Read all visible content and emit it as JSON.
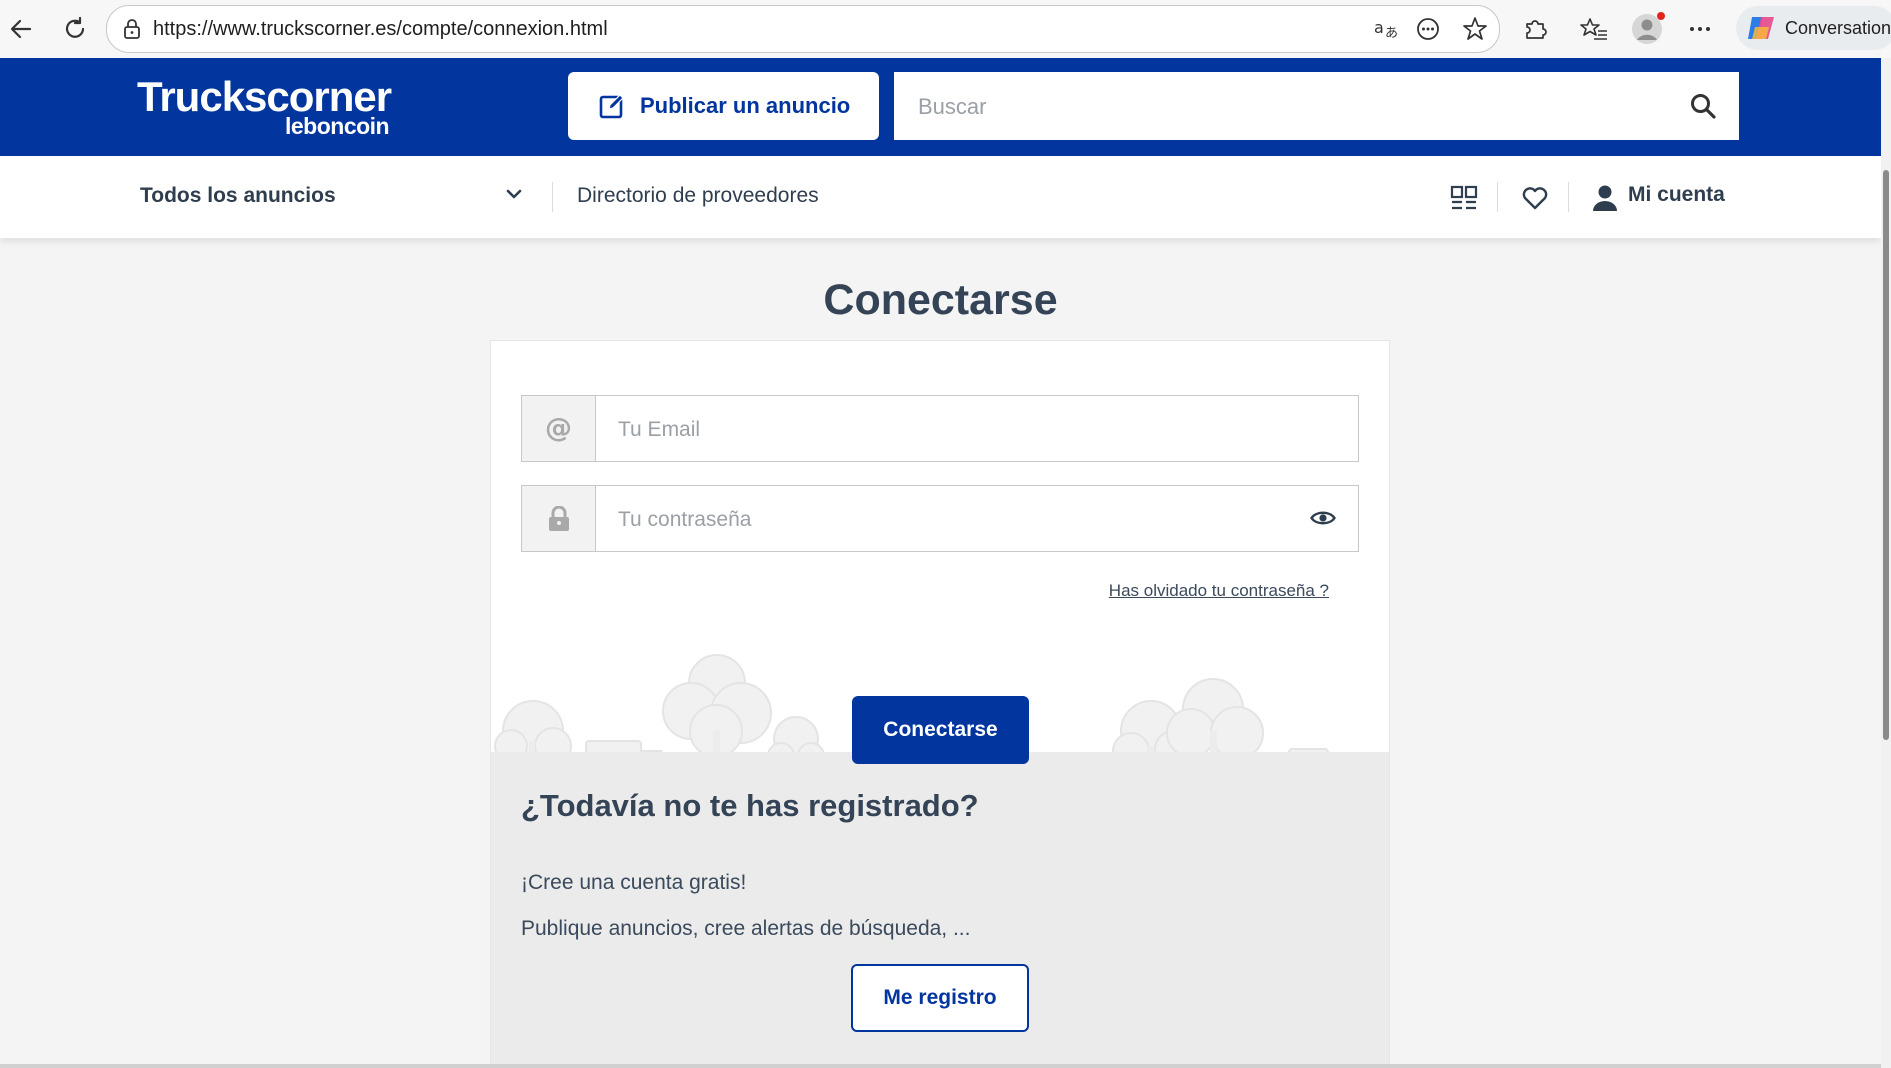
{
  "browser": {
    "url": "https://www.truckscorner.es/compte/connexion.html",
    "copilot_label": "Conversation"
  },
  "header": {
    "logo_main": "Truckscorner",
    "logo_sub": "leboncoin",
    "publish_label": "Publicar un anuncio",
    "search_placeholder": "Buscar"
  },
  "nav": {
    "all_ads": "Todos los anuncios",
    "directory": "Directorio de proveedores",
    "account": "Mi cuenta"
  },
  "login": {
    "title": "Conectarse",
    "email_placeholder": "Tu Email",
    "password_placeholder": "Tu contraseña",
    "forgot": "Has olvidado tu contraseña ?",
    "submit": "Conectarse"
  },
  "register": {
    "heading": "¿Todavía no te has registrado?",
    "line1": "¡Cree una cuenta gratis!",
    "line2": "Publique anuncios, cree alertas de búsqueda, ...",
    "button": "Me registro"
  },
  "colors": {
    "brand": "#02359e",
    "text": "#344456",
    "background": "#f4f4f4"
  }
}
